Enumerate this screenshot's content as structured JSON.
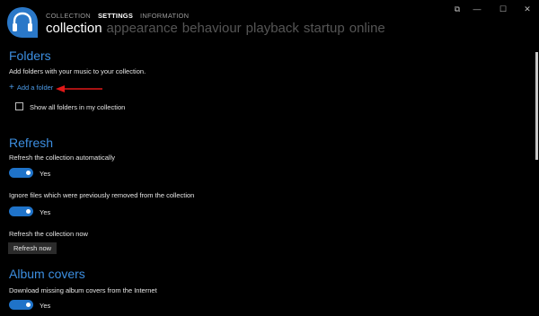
{
  "nav": {
    "top": [
      "COLLECTION",
      "SETTINGS",
      "INFORMATION"
    ],
    "active_top": "SETTINGS",
    "sub": [
      "collection",
      "appearance",
      "behaviour",
      "playback",
      "startup",
      "online"
    ],
    "active_sub": "collection"
  },
  "window_controls": {
    "restore": "⧉",
    "minimize": "—",
    "maximize": "☐",
    "close": "✕"
  },
  "folders": {
    "title": "Folders",
    "description": "Add folders with your music to your collection.",
    "add_folder": "Add a folder",
    "add_icon": "+",
    "show_all_label": "Show all folders in my collection",
    "show_all_checked": false
  },
  "refresh": {
    "title": "Refresh",
    "auto_label": "Refresh the collection automatically",
    "auto_value": "Yes",
    "ignore_label": "Ignore files which were previously removed from the collection",
    "ignore_value": "Yes",
    "now_label": "Refresh the collection now",
    "now_button": "Refresh now"
  },
  "album_covers": {
    "title": "Album covers",
    "download_label": "Download missing album covers from the Internet",
    "download_value": "Yes"
  },
  "colors": {
    "accent": "#1f73c9",
    "heading": "#3c8ee0",
    "annotation_arrow": "#e01818"
  },
  "icons": [
    "headphones-logo-icon",
    "plus-icon",
    "restore-icon",
    "minimize-icon",
    "maximize-icon",
    "close-icon"
  ]
}
